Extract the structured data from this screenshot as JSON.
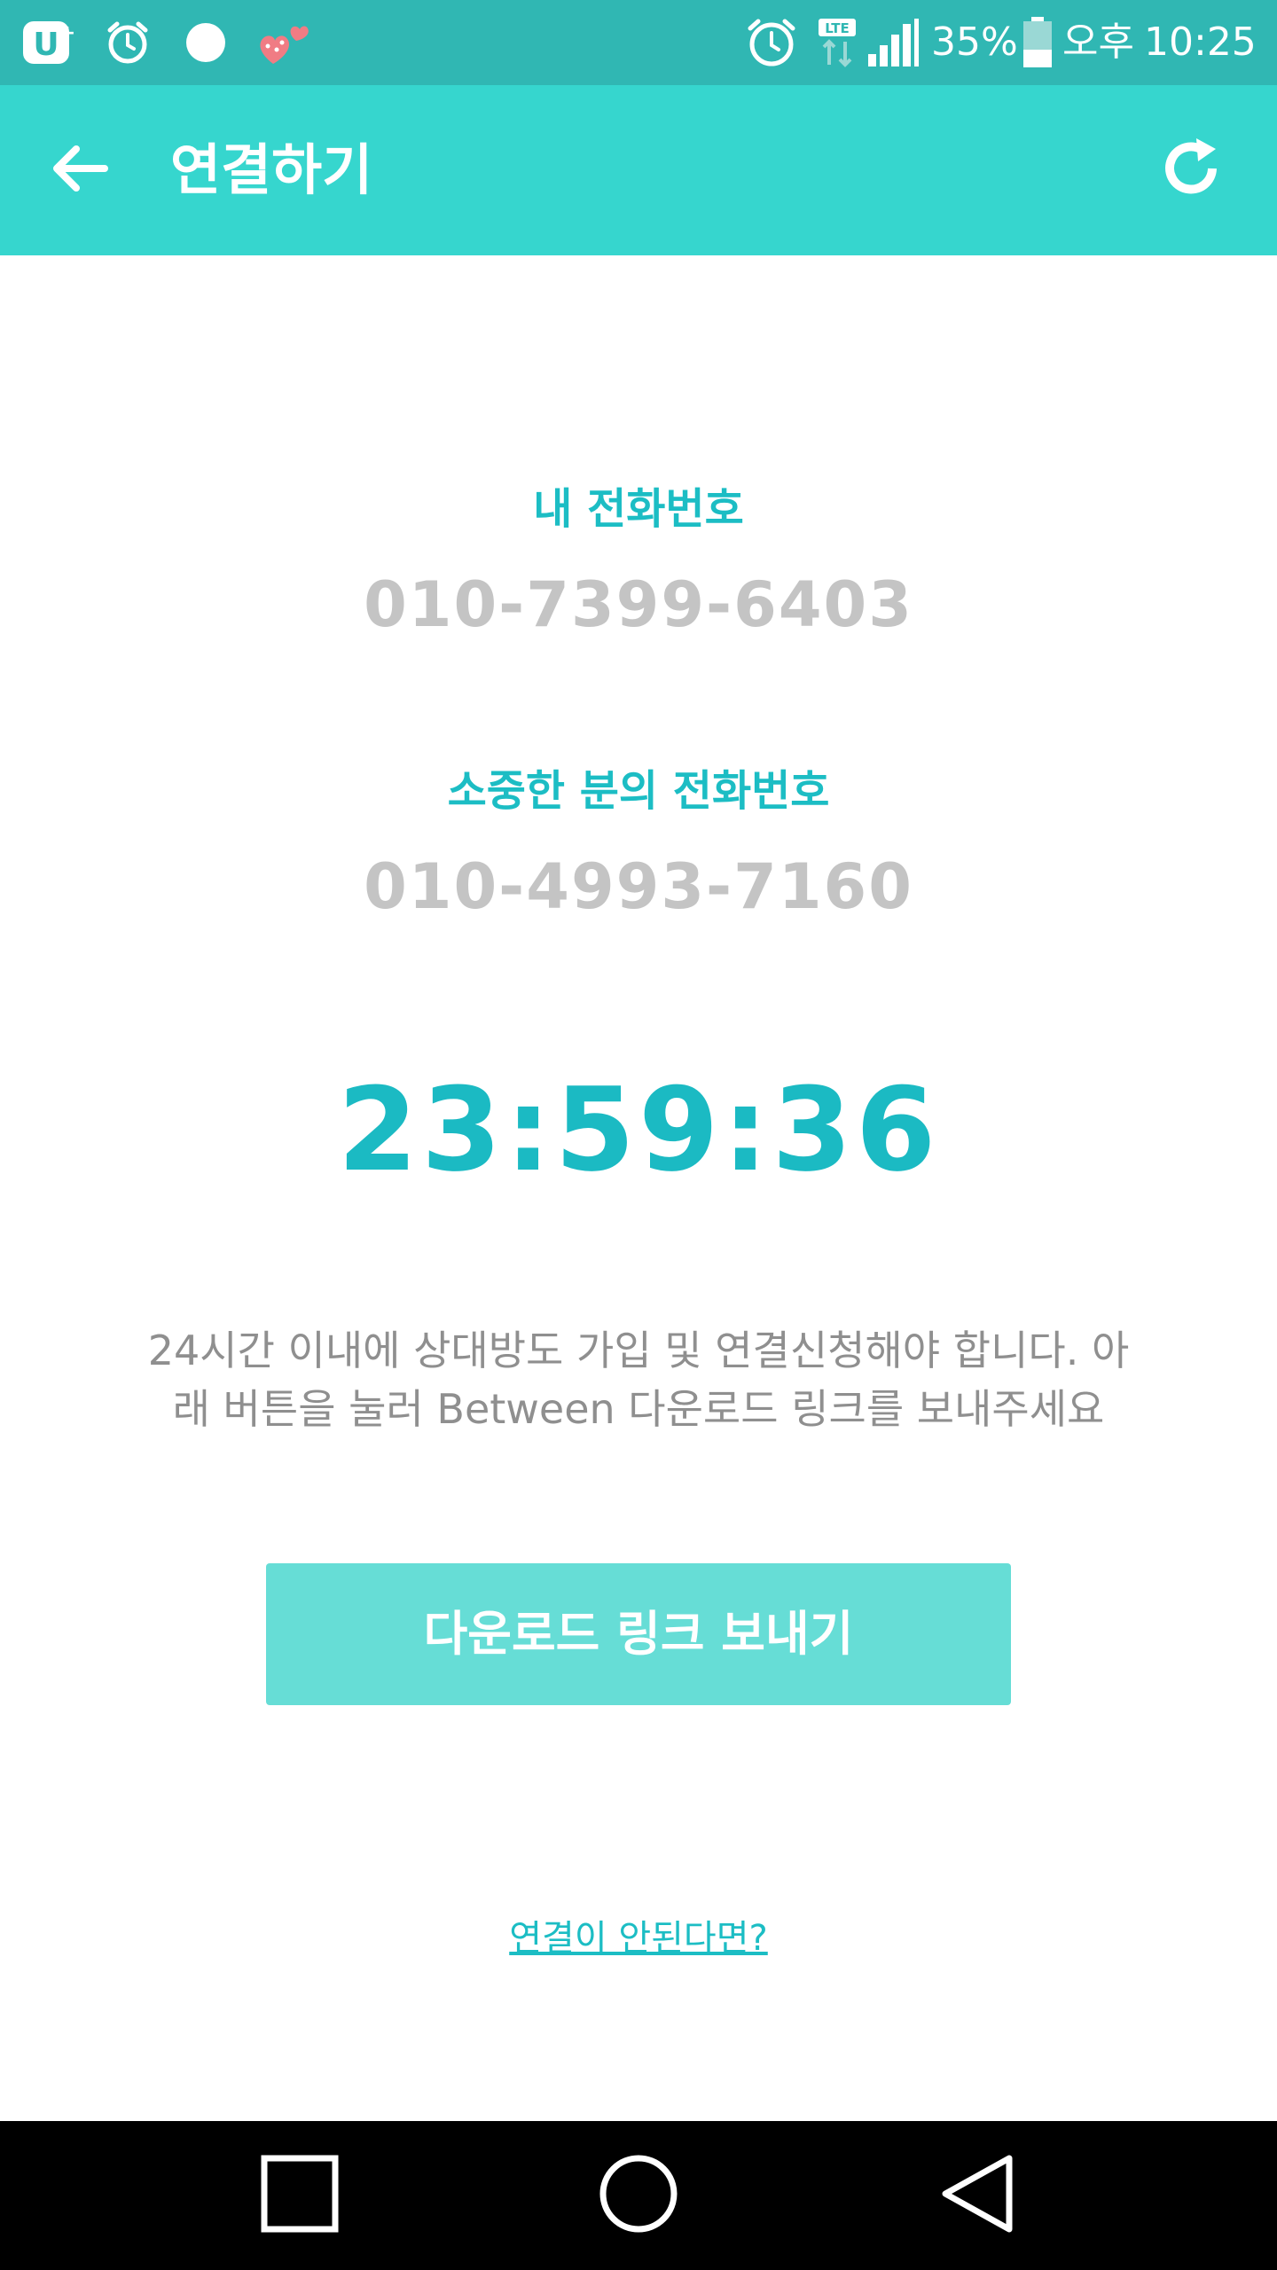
{
  "status_bar": {
    "icons": [
      "carrier-u-icon",
      "alarm-icon",
      "circle-icon",
      "hearts-icon",
      "alarm-icon",
      "lte-icon",
      "signal-icon",
      "battery-icon"
    ],
    "battery_percent": "35%",
    "time_period": "오후",
    "time": "10:25"
  },
  "app_bar": {
    "title": "연결하기",
    "back_icon": "arrow-left-icon",
    "refresh_icon": "refresh-icon"
  },
  "my_phone": {
    "label": "내 전화번호",
    "number": "010-7399-6403"
  },
  "partner_phone": {
    "label": "소중한 분의 전화번호",
    "number": "010-4993-7160"
  },
  "countdown": "23:59:36",
  "instruction": "24시간 이내에 상대방도 가입 및 연결신청해야 합니다. 아래 버튼을 눌러 Between 다운로드 링크를 보내주세요",
  "download_button": "다운로드 링크 보내기",
  "help_link": "연결이 안된다면?",
  "nav_bar": {
    "icons": [
      "recent-apps-icon",
      "home-icon",
      "back-triangle-icon"
    ]
  },
  "colors": {
    "status_bar": "#30b7b3",
    "app_bar": "#36d6ce",
    "accent": "#1cbdc4",
    "button": "#66ddd6",
    "phone_text": "#c4c4c4",
    "body_text": "#8f8f8f"
  }
}
